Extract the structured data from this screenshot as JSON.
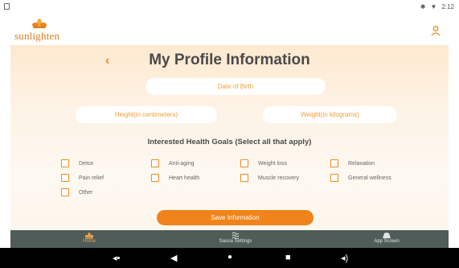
{
  "status": {
    "time": "2:12"
  },
  "app": {
    "logo_text": "sunlighten"
  },
  "page": {
    "back_glyph": "‹",
    "title": "My Profile Information"
  },
  "fields": {
    "dob_placeholder": "Date of Birth",
    "height_placeholder": "Height(in centimeters)",
    "weight_placeholder": "Weight(in kilograms)"
  },
  "goals": {
    "title": "Interested Health Goals (Select all that apply)",
    "items": [
      "Detox",
      "Anti-aging",
      "Weight loss",
      "Relaxation",
      "Pain relief",
      "Heart health",
      "Muscle recovery",
      "General wellness",
      "Other"
    ]
  },
  "actions": {
    "save_label": "Save Information"
  },
  "nav": {
    "home": "Home",
    "sauna": "Sauna Settings",
    "app": "App Screen"
  },
  "colors": {
    "accent": "#f0841a",
    "nav_bg": "#4f5c57",
    "title": "#4a4a4a"
  },
  "icons": {
    "status": [
      "bluetooth-icon",
      "wifi-icon"
    ],
    "user": "user-icon",
    "nav": [
      "home-icon",
      "sauna-settings-icon",
      "app-screen-icon"
    ],
    "system": [
      "volume-down-icon",
      "back-icon",
      "home-circle-icon",
      "recents-icon",
      "volume-up-icon"
    ]
  }
}
